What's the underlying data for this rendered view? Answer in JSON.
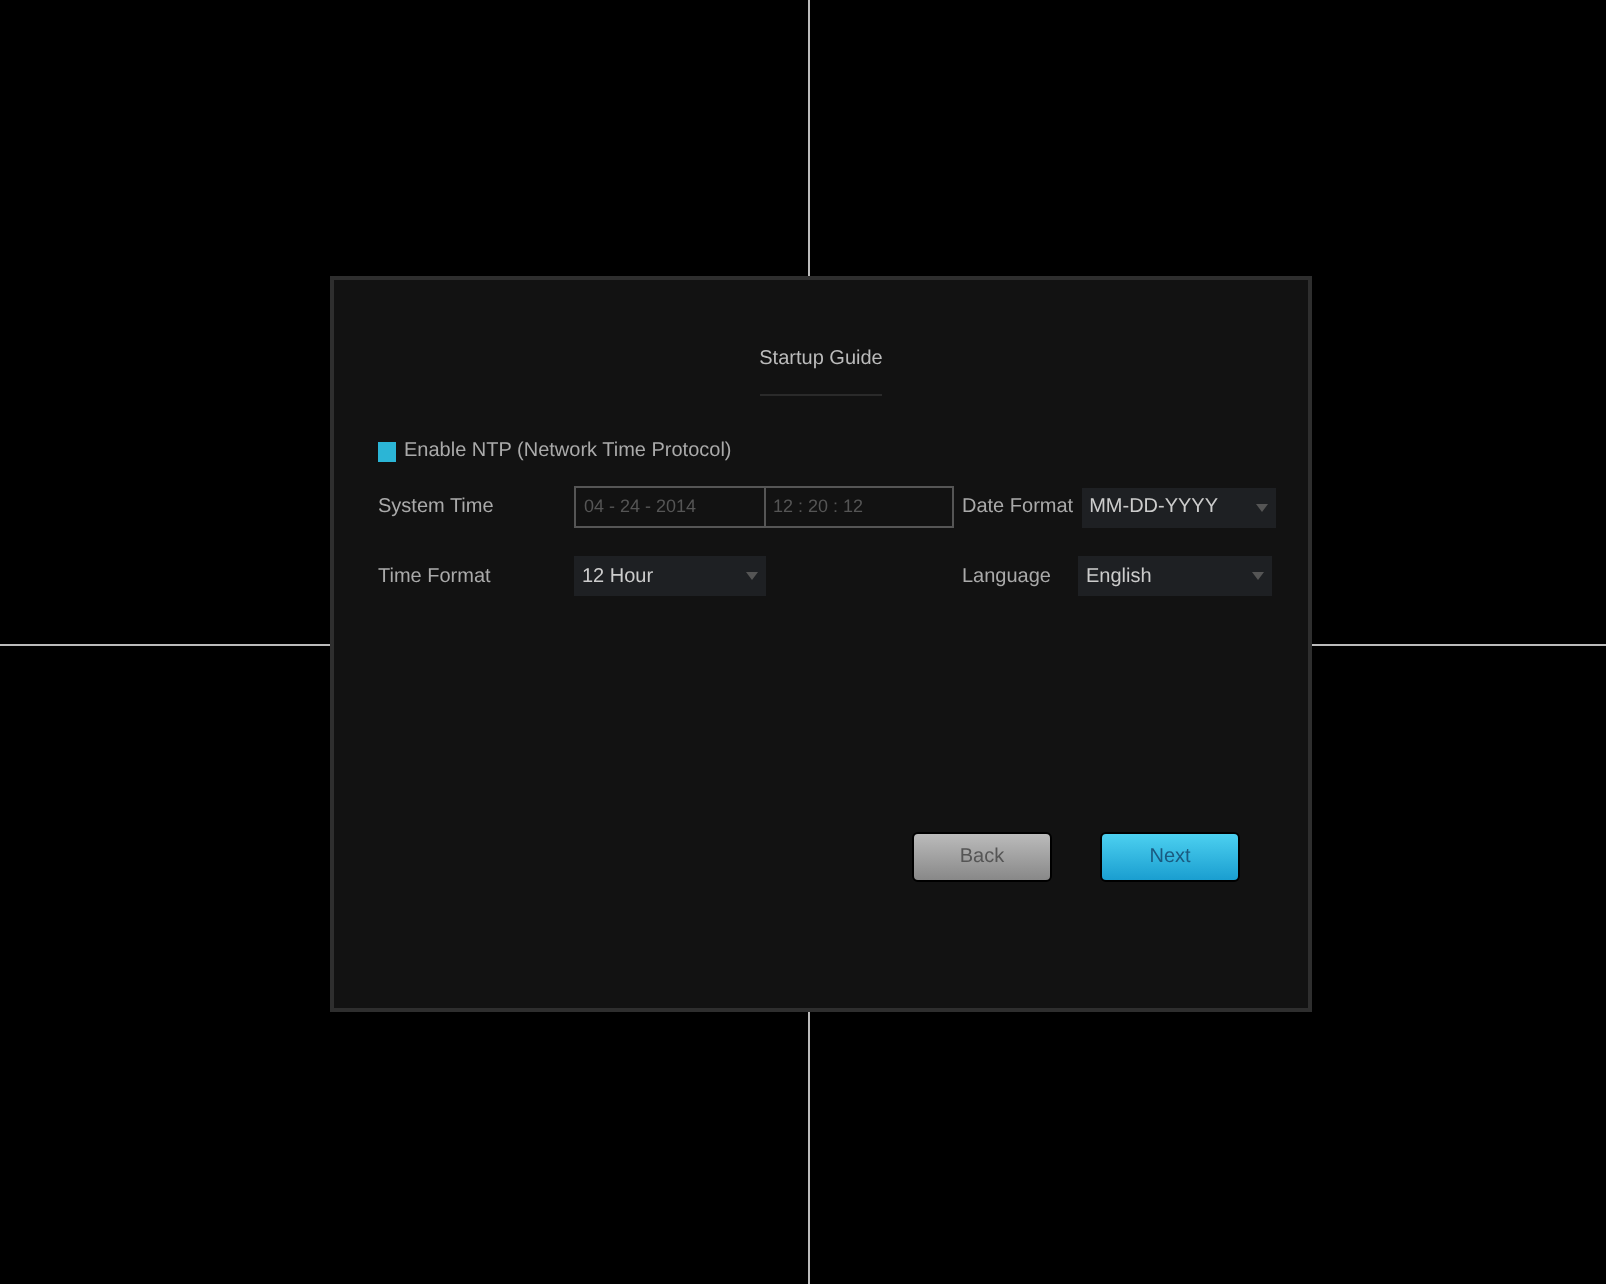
{
  "dialog": {
    "title": "Startup Guide",
    "ntp": {
      "label": "Enable NTP (Network Time Protocol)",
      "checked": true
    },
    "system_time": {
      "label": "System Time",
      "date": "04 - 24 - 2014",
      "time": "12 : 20 : 12",
      "disabled": true
    },
    "date_format": {
      "label": "Date Format",
      "value": "MM-DD-YYYY"
    },
    "time_format": {
      "label": "Time Format",
      "value": "12 Hour"
    },
    "language": {
      "label": "Language",
      "value": "English"
    },
    "buttons": [
      {
        "label": "Back",
        "kind": "secondary"
      },
      {
        "label": "Next",
        "kind": "primary"
      }
    ]
  }
}
